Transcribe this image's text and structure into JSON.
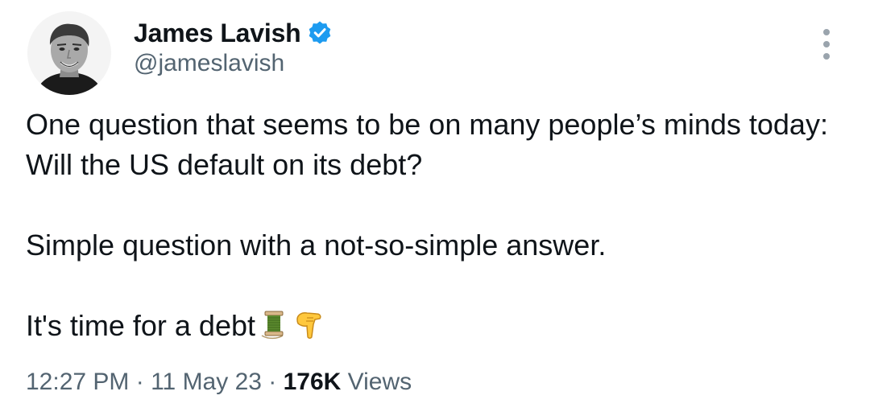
{
  "author": {
    "display_name": "James Lavish",
    "handle": "@jameslavish",
    "verified": true,
    "verified_color": "#1d9bf0"
  },
  "tweet": {
    "line1": "One question that seems to be on many people’s minds today: Will the US default on its debt?",
    "line2": "Simple question with a not-so-simple answer.",
    "line3": "It's time for a debt",
    "emojis": [
      "thread-emoji",
      "pointing-down-emoji"
    ]
  },
  "meta": {
    "time": "12:27 PM",
    "separator1": " · ",
    "date": "11 May 23",
    "separator2": " · ",
    "views_count": "176K",
    "views_label": " Views"
  },
  "colors": {
    "text_primary": "#0f1419",
    "text_secondary": "#536471",
    "more_dots": "#9aa4ad"
  }
}
